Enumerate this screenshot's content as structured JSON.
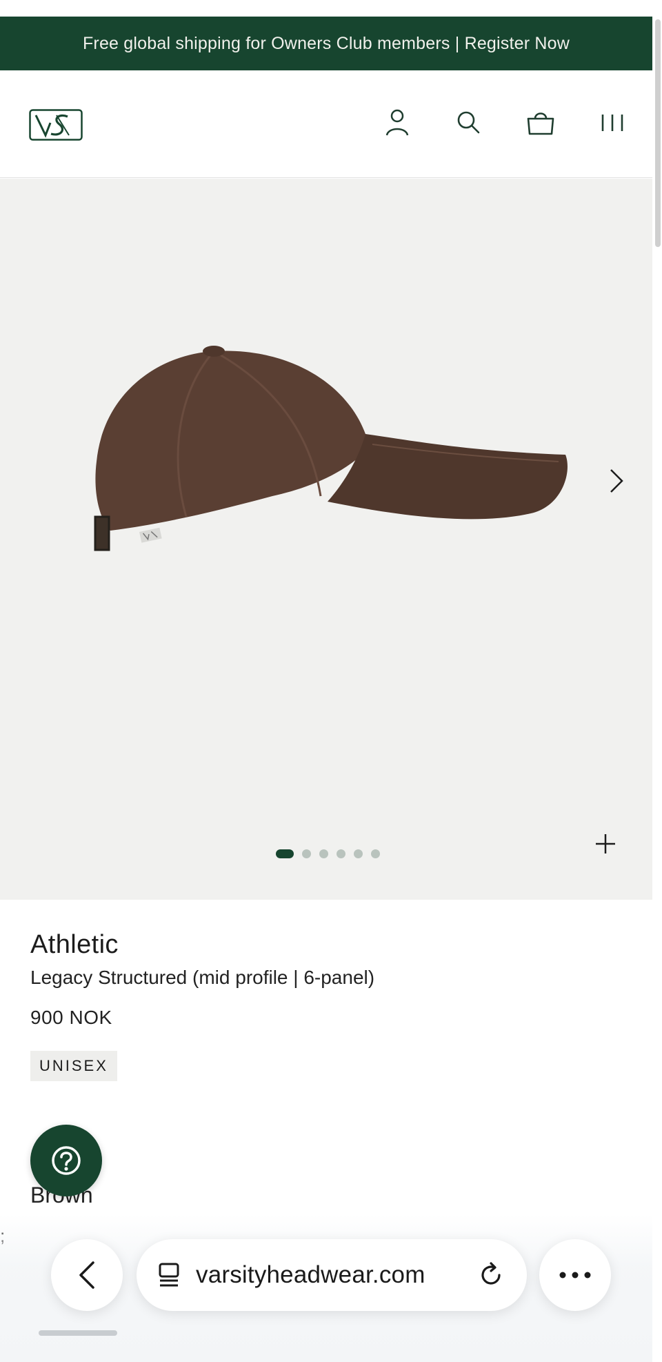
{
  "promo": {
    "text": "Free global shipping for Owners Club members | Register Now",
    "background": "#17452f"
  },
  "header": {
    "logo_icon": "vs-monogram-logo",
    "icons": [
      "account-icon",
      "search-icon",
      "shopping-bag-icon",
      "menu-icon"
    ]
  },
  "gallery": {
    "image": "brown-cap-side-view",
    "slide_count": 6,
    "active_slide": 1,
    "next_icon": "chevron-right-icon",
    "zoom_icon": "plus-icon"
  },
  "product": {
    "brand": "Athletic",
    "name": "Legacy Structured (mid profile | 6-panel)",
    "price": "900 NOK",
    "badge": "UNISEX",
    "color": "Brown"
  },
  "stray_text": ";",
  "help": {
    "icon": "question-icon"
  },
  "browser": {
    "url": "varsityheadwear.com",
    "back_icon": "chevron-left-icon",
    "tabs_icon": "tabs-icon",
    "reload_icon": "reload-icon",
    "more_icon": "ellipsis-icon"
  },
  "colors": {
    "brand_green": "#17452f",
    "gallery_bg": "#f1f1ef",
    "cap_brown": "#5a3f33"
  }
}
